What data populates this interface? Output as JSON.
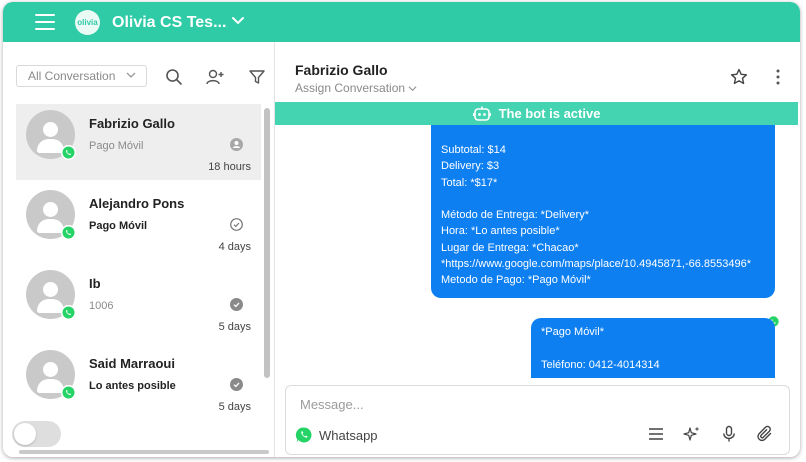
{
  "app": {
    "title": "Olivia CS Tes...",
    "logo_text": "olivia"
  },
  "sidebar": {
    "filter_label": "All Conversation",
    "conversations": [
      {
        "name": "Fabrizio Gallo",
        "preview": "Pago Móvil",
        "time": "18 hours",
        "status_icon": "user-circle-icon"
      },
      {
        "name": "Alejandro Pons",
        "preview": "Pago Móvil",
        "time": "4 days",
        "status_icon": "check-outline-icon"
      },
      {
        "name": "Ib",
        "preview": "1006",
        "time": "5 days",
        "status_icon": "check-filled-icon"
      },
      {
        "name": "Said Marraoui",
        "preview": "Lo antes posible",
        "time": "5 days",
        "status_icon": "check-filled-icon"
      }
    ]
  },
  "chat": {
    "contact_name": "Fabrizio Gallo",
    "assign_label": "Assign Conversation",
    "bot_banner": "The bot is active",
    "messages": [
      "Subtotal: $14\nDelivery: $3\nTotal: *$17*\n\nMétodo de Entrega: *Delivery*\nHora: *Lo antes posible*\nLugar de Entrega: *Chacao*\n*https://www.google.com/maps/place/10.4945871,-66.8553496*\nMetodo de Pago: *Pago Móvil*",
      "*Pago Móvil*\n\nTeléfono: 0412-4014314"
    ],
    "composer_placeholder": "Message...",
    "channel_label": "Whatsapp"
  },
  "colors": {
    "brand": "#2ecba6",
    "banner": "#45d4b1",
    "bubble": "#0d7ff0",
    "whatsapp": "#25d366"
  }
}
